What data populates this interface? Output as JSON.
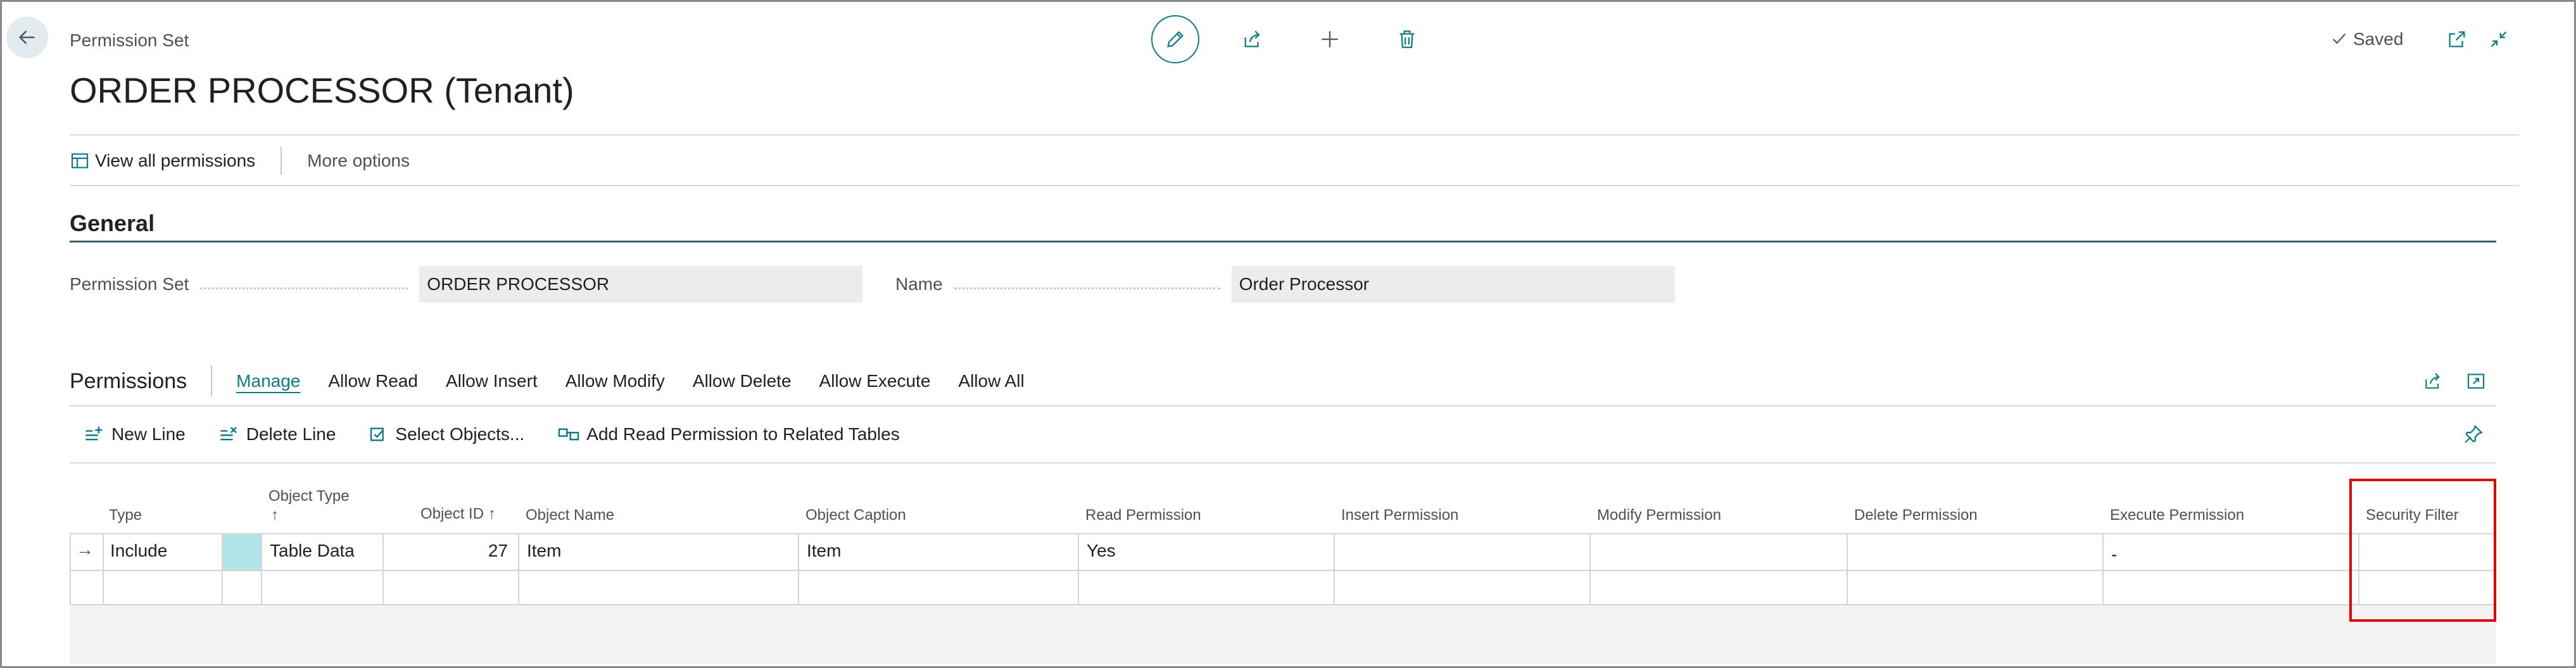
{
  "header": {
    "caption": "Permission Set",
    "title": "ORDER PROCESSOR (Tenant)",
    "saved_label": "Saved"
  },
  "icons": {
    "back": "arrow-left-icon",
    "edit": "pencil-icon",
    "share": "share-icon",
    "new": "plus-icon",
    "delete": "trash-icon",
    "open_new_window": "open-in-new-window-icon",
    "collapse": "collapse-icon"
  },
  "actionbar": {
    "view_all": "View all permissions",
    "more_options": "More options"
  },
  "general": {
    "title": "General",
    "permission_set_label": "Permission Set",
    "permission_set_value": "ORDER PROCESSOR",
    "name_label": "Name",
    "name_value": "Order Processor"
  },
  "permissions": {
    "title": "Permissions",
    "tabs": [
      "Manage",
      "Allow Read",
      "Allow Insert",
      "Allow Modify",
      "Allow Delete",
      "Allow Execute",
      "Allow All"
    ],
    "actions": [
      "New Line",
      "Delete Line",
      "Select Objects...",
      "Add Read Permission to Related Tables"
    ]
  },
  "grid": {
    "columns": {
      "type": "Type",
      "object_type": "Object Type",
      "object_type_sort": "↑",
      "object_id": "Object ID ↑",
      "object_name": "Object Name",
      "object_caption": "Object Caption",
      "read": "Read Permission",
      "insert": "Insert Permission",
      "modify": "Modify Permission",
      "delete": "Delete Permission",
      "execute": "Execute Permission",
      "security_filter": "Security Filter"
    },
    "rows": [
      {
        "indicator": "→",
        "type": "Include",
        "object_type": "Table Data",
        "object_id": "27",
        "object_name": "Item",
        "object_caption": "Item",
        "read": "Yes",
        "insert": "",
        "modify": "",
        "delete": "",
        "execute": "-",
        "security_filter": ""
      }
    ]
  },
  "colors": {
    "accent": "#0c7c84",
    "highlight": "#e00000",
    "selected_cell": "#b1e4e6"
  }
}
